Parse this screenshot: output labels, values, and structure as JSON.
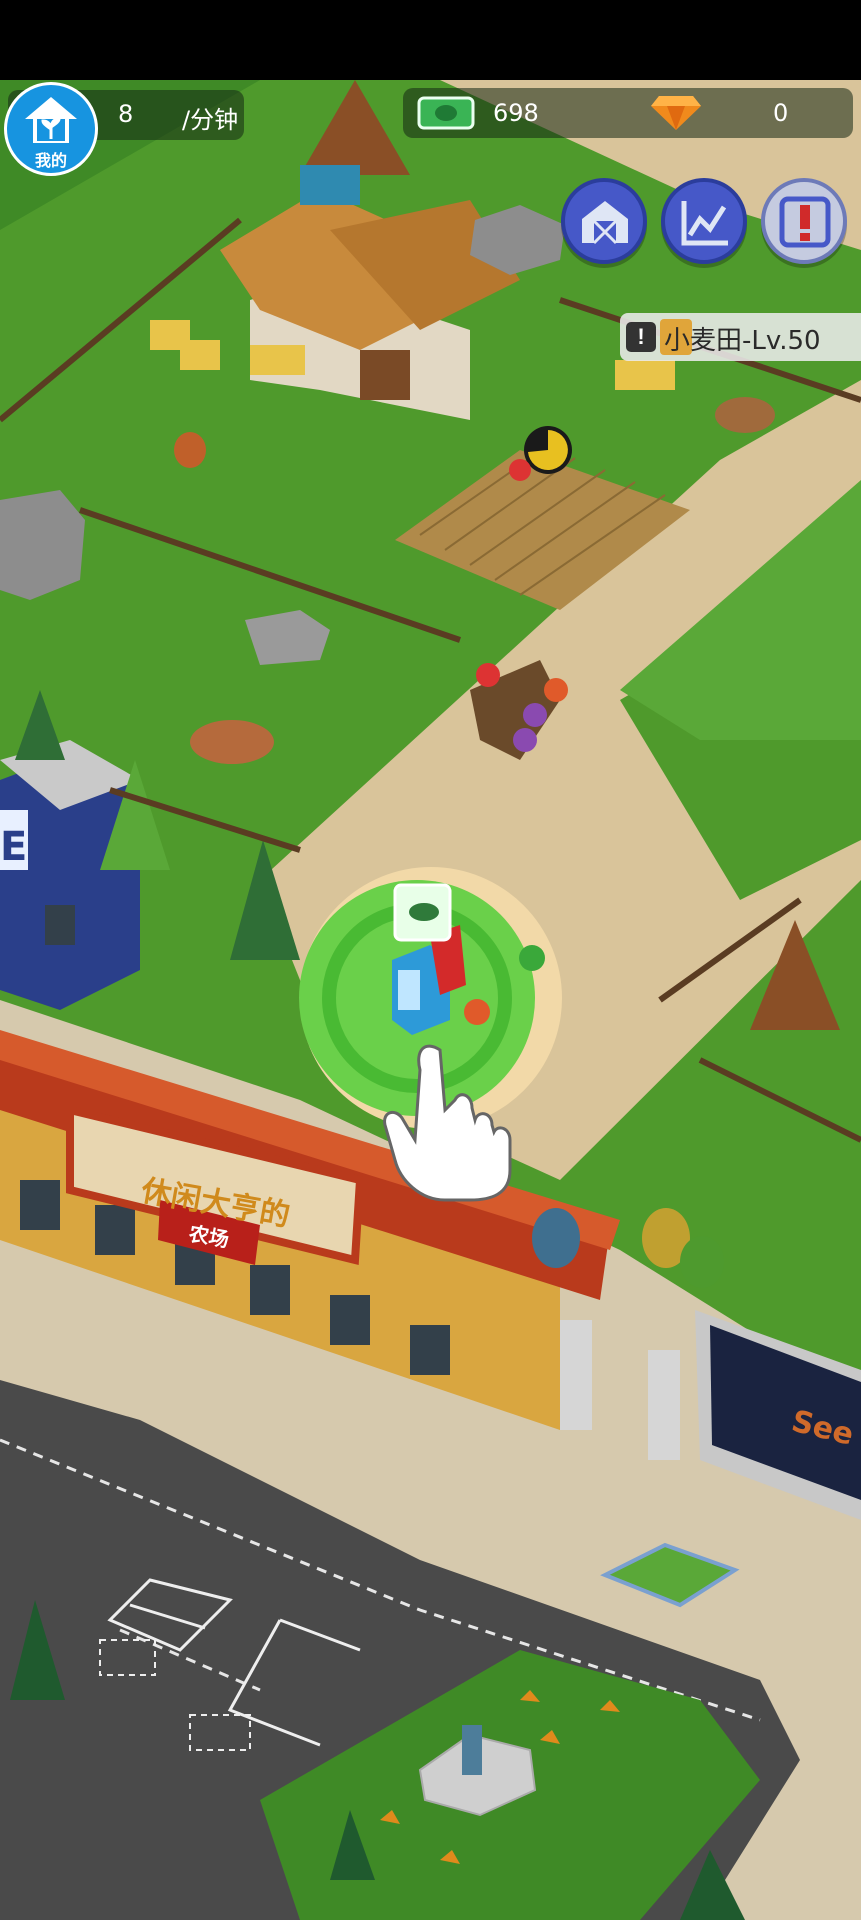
{
  "hud": {
    "rate_value": "8",
    "rate_unit": "/分钟",
    "home_label": "我的",
    "cash_value": "698",
    "gem_value": "0"
  },
  "field_tag": {
    "alert_glyph": "!",
    "label": "小麦田-Lv.50"
  },
  "buttons": {
    "barn_icon": "barn-icon",
    "stats_icon": "chart-icon",
    "alert_icon": "exclamation-icon"
  },
  "farm_sign": {
    "title": "休闲大亨的",
    "subtitle": "农场"
  },
  "billboard": {
    "text": "See y"
  },
  "colors": {
    "grass": "#4f9a2c",
    "dirt": "#d9c49a",
    "road": "#4a4a4a",
    "hud_blue": "#4658c8",
    "home_blue": "#1794e0",
    "gem": "#f08a1c",
    "cash": "#3ab455",
    "roof_red": "#b93a1c"
  }
}
